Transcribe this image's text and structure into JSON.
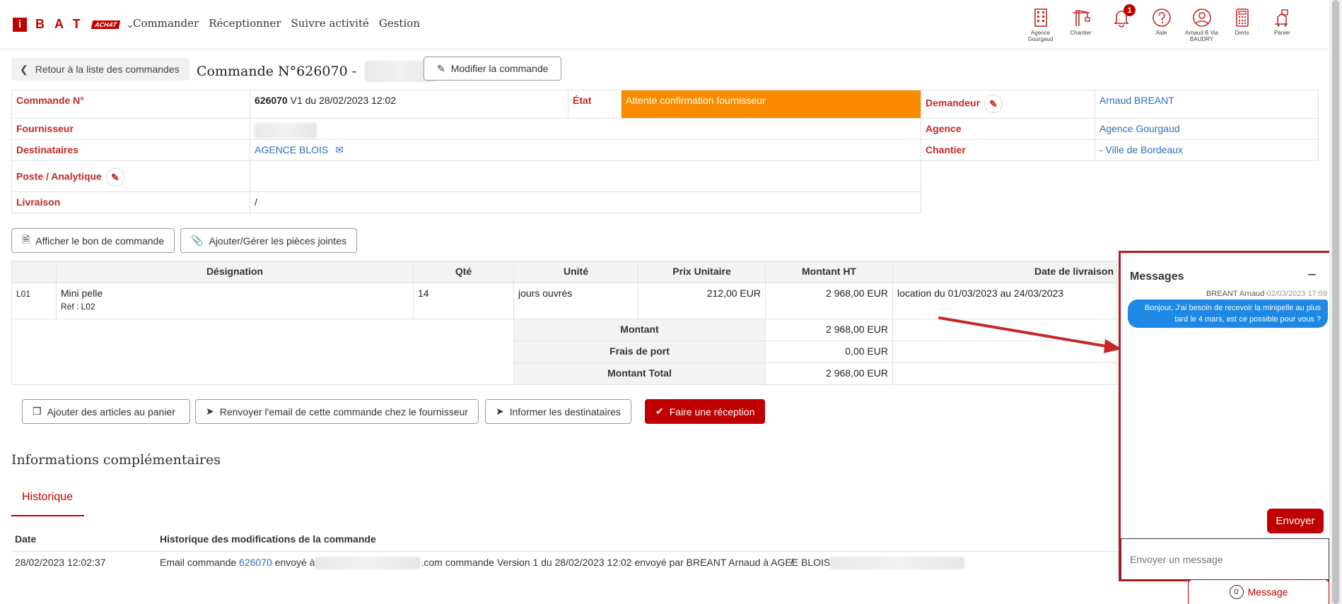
{
  "brand": {
    "letter": "i",
    "name": "BAT",
    "badge": "ACHAT"
  },
  "nav": [
    "Commander",
    "Réceptionner",
    "Suivre activité",
    "Gestion"
  ],
  "tools": [
    {
      "icon": "building-icon",
      "label": "Agence Gourgaud"
    },
    {
      "icon": "crane-icon",
      "label": "Chantier"
    },
    {
      "icon": "bell-icon",
      "label": "",
      "badge": "1"
    },
    {
      "icon": "help-icon",
      "label": "Aide"
    },
    {
      "icon": "user-icon",
      "label": "Arnaud B Via BAUDRY"
    },
    {
      "icon": "calculator-icon",
      "label": "Devis"
    },
    {
      "icon": "cart-icon",
      "label": "Panier"
    }
  ],
  "header": {
    "back_label": "Retour à la liste des commandes",
    "title": "Commande N°626070 -",
    "modify_label": "Modifier la commande"
  },
  "info": {
    "order_label": "Commande N°",
    "order_number": "626070",
    "order_version": " V1 du 28/02/2023 12:02",
    "state_label": "État",
    "state_value": "Attente confirmation fournisseur",
    "requester_label": "Demandeur",
    "requester_value": "Arnaud BREANT",
    "supplier_label": "Fournisseur",
    "agency_label": "Agence",
    "agency_value": "Agence Gourgaud",
    "recipients_label": "Destinataires",
    "recipients_value": "AGENCE BLOIS",
    "site_label": "Chantier",
    "site_value": "- Ville de Bordeaux",
    "post_label": "Poste / Analytique",
    "delivery_label": "Livraison",
    "delivery_value": "/"
  },
  "doc_buttons": {
    "show_order": "Afficher le bon de commande",
    "attachments": "Ajouter/Gérer les pièces jointes"
  },
  "table": {
    "headers": [
      "Désignation",
      "Qté",
      "Unité",
      "Prix Unitaire",
      "Montant HT",
      "Date de livraison"
    ],
    "row": {
      "line": "L01",
      "designation": "Mini pelle",
      "ref": "Réf : L02",
      "qty": "14",
      "unit": "jours ouvrés",
      "unit_price": "212,00 EUR",
      "amount": "2 968,00 EUR",
      "delivery": "location du 01/03/2023 au 24/03/2023"
    },
    "totals": [
      {
        "label": "Montant",
        "value": "2 968,00 EUR"
      },
      {
        "label": "Frais de port",
        "value": "0,00 EUR"
      },
      {
        "label": "Montant Total",
        "value": "2 968,00 EUR"
      }
    ]
  },
  "actions": {
    "add_cart": "Ajouter des articles au panier",
    "resend": "Renvoyer l'email de cette commande chez le fournisseur",
    "inform": "Informer les destinataires",
    "receive": "Faire une réception"
  },
  "extra": {
    "title": "Informations complémentaires",
    "tab": "Historique",
    "col_date": "Date",
    "col_history": "Historique des modifications de la commande",
    "entry_date": "28/02/2023 12:02:37",
    "entry_prefix": "Email commande ",
    "entry_link": "626070",
    "entry_mid": " envoyé à",
    "entry_suffix": ".com commande Version 1 du 28/02/2023 12:02 envoyé par BREANT Arnaud à AGE̸E BLOIS"
  },
  "messages": {
    "title": "Messages",
    "author": "BREANT Arnaud",
    "date": "02/03/2023 17:59",
    "text": "Bonjour, J'ai besoin de recevoir la minipelle au plus tard le 4 mars, est ce possible pour vous ?",
    "send_label": "Envoyer",
    "input_placeholder": "Envoyer un message",
    "toggle_count": "0",
    "toggle_label": "Message"
  },
  "colors": {
    "brand": "#c00000",
    "state": "#fb8c00",
    "bubble": "#1e88e5",
    "link": "#2f6fb5"
  }
}
